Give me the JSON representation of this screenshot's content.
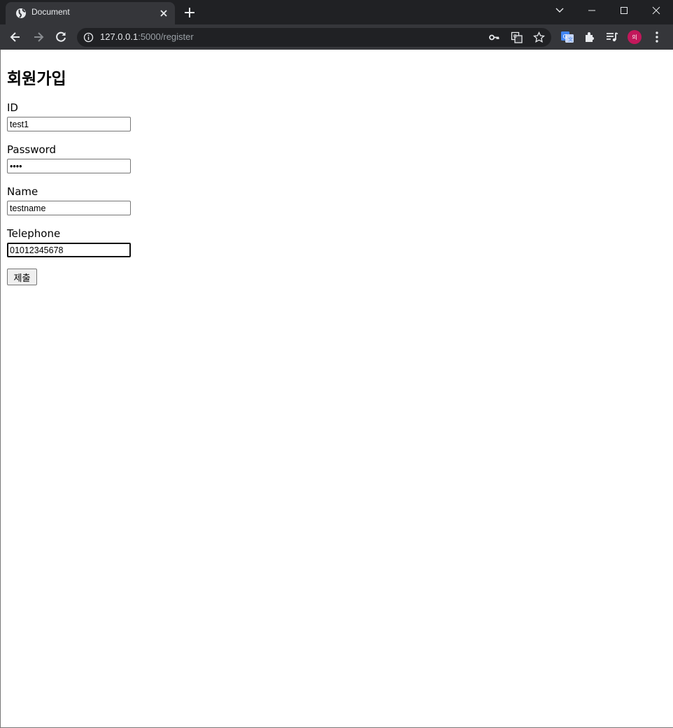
{
  "browser": {
    "tab_title": "Document",
    "url_host": "127.0.0.1",
    "url_rest": ":5000/register",
    "avatar_text": "의",
    "icons": [
      "globe-icon",
      "close-icon",
      "plus-icon",
      "chevron-down-icon",
      "minimize-icon",
      "maximize-icon",
      "window-close-icon",
      "back-icon",
      "forward-icon",
      "reload-icon",
      "info-icon",
      "key-icon",
      "translate-icon",
      "star-icon",
      "google-translate-icon",
      "puzzle-icon",
      "reading-list-icon",
      "menu-dots-icon"
    ]
  },
  "form": {
    "heading": "회원가입",
    "fields": [
      {
        "label": "ID",
        "value": "test1"
      },
      {
        "label": "Password",
        "value": "••••"
      },
      {
        "label": "Name",
        "value": "testname"
      },
      {
        "label": "Telephone",
        "value": "01012345678"
      }
    ],
    "submit_label": "제출"
  }
}
